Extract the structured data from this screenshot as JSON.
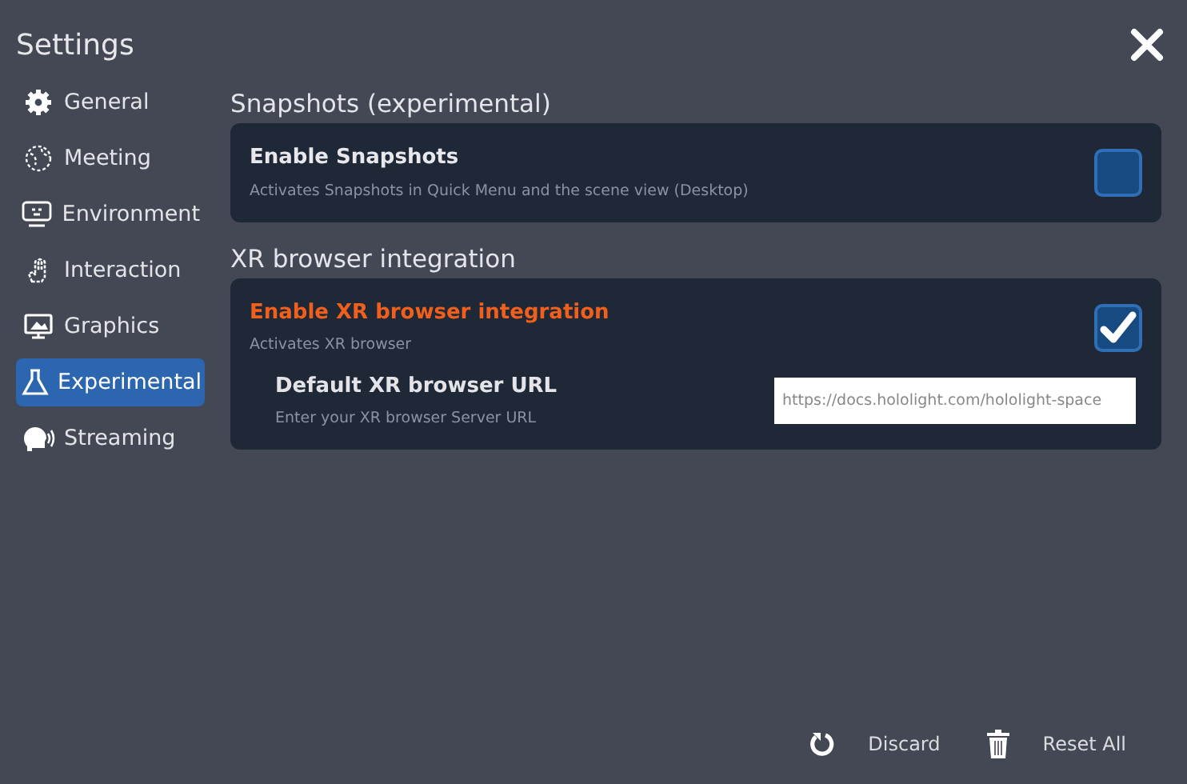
{
  "window": {
    "title": "Settings"
  },
  "sidebar": {
    "items": [
      {
        "label": "General",
        "selected": false
      },
      {
        "label": "Meeting",
        "selected": false
      },
      {
        "label": "Environment",
        "selected": false
      },
      {
        "label": "Interaction",
        "selected": false
      },
      {
        "label": "Graphics",
        "selected": false
      },
      {
        "label": "Experimental",
        "selected": true
      },
      {
        "label": "Streaming",
        "selected": false
      }
    ]
  },
  "sections": [
    {
      "heading": "Snapshots (experimental)",
      "settings": [
        {
          "label": "Enable Snapshots",
          "description": "Activates Snapshots in Quick Menu and the scene view (Desktop)",
          "checked": false,
          "highlighted": false
        }
      ]
    },
    {
      "heading": "XR browser integration",
      "settings": [
        {
          "label": "Enable XR browser integration",
          "description": "Activates XR browser",
          "checked": true,
          "highlighted": true,
          "field": {
            "label": "Default XR browser URL",
            "description": "Enter your XR browser Server URL",
            "value": "https://docs.hololight.com/hololight-space"
          }
        }
      ]
    }
  ],
  "footer": {
    "buttons": [
      "Discard",
      "Reset All"
    ]
  }
}
